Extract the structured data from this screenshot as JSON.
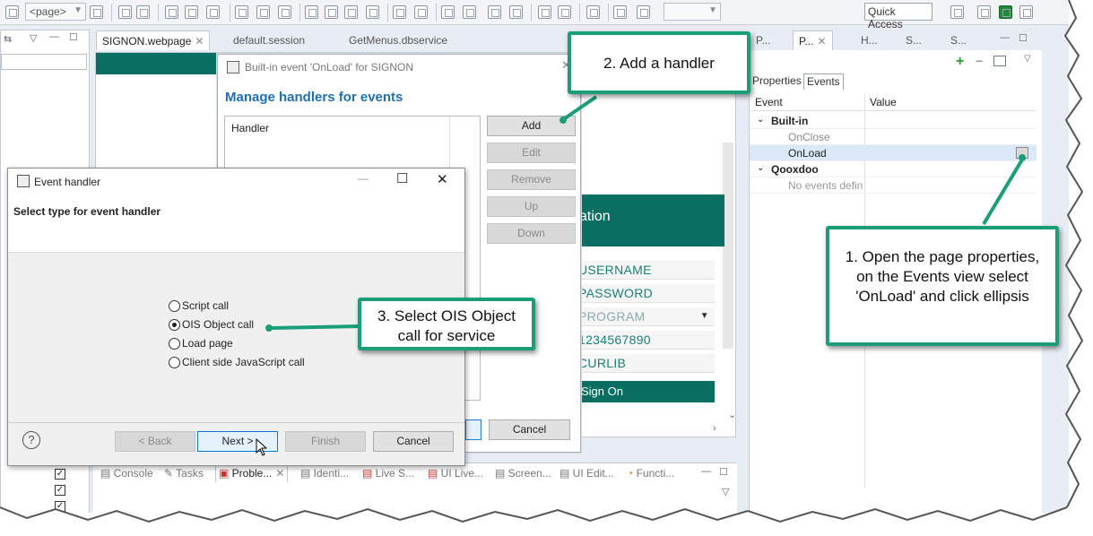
{
  "toolbar": {
    "page_combo": "<page>",
    "quick_access": "Quick Access"
  },
  "editor_tabs": [
    {
      "label": "SIGNON.webpage",
      "close": "✕"
    },
    {
      "label": "default.session"
    },
    {
      "label": "GetMenus.dbservice"
    }
  ],
  "right_tabs": {
    "t1": "P...",
    "t2": "P...",
    "t2_close": "✕",
    "t3": "H...",
    "t4": "S...",
    "t5": "S..."
  },
  "properties": {
    "tabs": [
      "Properties",
      "Events"
    ],
    "col_event": "Event",
    "col_value": "Value",
    "group_builtin": "Built-in",
    "item_onclose": "OnClose",
    "item_onload": "OnLoad",
    "group_qooxdoo": "Qooxdoo",
    "item_none": "No events defin"
  },
  "handlers_dialog": {
    "title": "Built-in event 'OnLoad' for SIGNON",
    "heading": "Manage handlers for events",
    "list_header": "Handler",
    "add": "Add",
    "edit": "Edit",
    "remove": "Remove",
    "up": "Up",
    "down": "Down",
    "cancel": "Cancel"
  },
  "page_preview": {
    "band_text": "ation",
    "fields": [
      "USERNAME",
      "PASSWORD",
      "PROGRAM",
      "1234567890",
      "CURLIB"
    ],
    "button": "Sign On"
  },
  "event_handler_dialog": {
    "title": "Event handler",
    "heading": "Select type for event handler",
    "options": [
      "Script call",
      "OIS Object call",
      "Load page",
      "Client side JavaScript call"
    ],
    "selected_index": 1,
    "help": "?",
    "back": "< Back",
    "next": "Next >",
    "finish": "Finish",
    "cancel": "Cancel",
    "minimize": "—",
    "maximize": "☐",
    "close": "✕"
  },
  "bottom_tabs": [
    "Console",
    "Tasks",
    "Proble...",
    "Identi...",
    "Live S...",
    "UI Live...",
    "Screen...",
    "UI Edit...",
    "Functi..."
  ],
  "callouts": {
    "c1": "1. Open the page properties, on the Events view select 'OnLoad' and click ellipsis",
    "c2": "2. Add a handler",
    "c3": "3. Select OIS Object call for service"
  },
  "colors": {
    "accent_green": "#1a9e78",
    "page_teal": "#0a6f63",
    "heading_blue": "#1f6fb2"
  }
}
